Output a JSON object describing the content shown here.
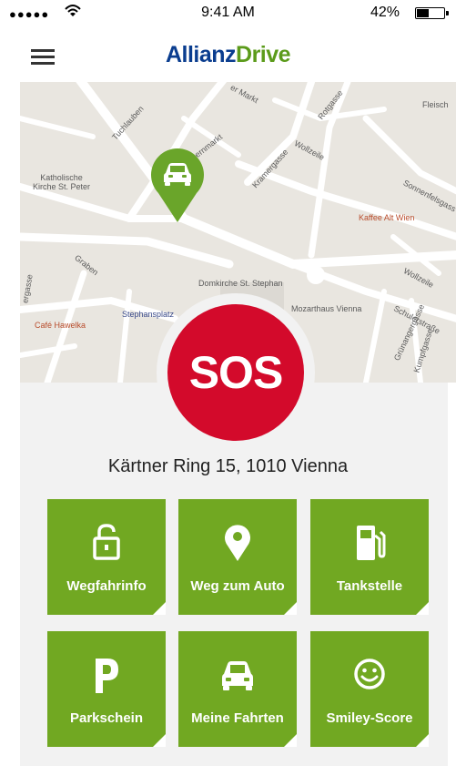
{
  "statusbar": {
    "signal": "●●●●●",
    "time": "9:41 AM",
    "battery": "42%",
    "battery_level": 0.42
  },
  "app": {
    "brand_part1": "Allianz",
    "brand_part2": "Drive"
  },
  "map": {
    "labels": {
      "tuchlauben": "Tuchlauben",
      "hoher_markt": "er Markt",
      "rotgasse": "Rotgasse",
      "fleisch": "Fleisch",
      "bauernmarkt": "Bauernmarkt",
      "kramergasse": "Kramergasse",
      "wollzeile1": "Wollzeile",
      "sonnenfels": "Sonnenfelsgass",
      "kirche": "Katholische\nKirche St. Peter",
      "kaffee": "Kaffee Alt Wien",
      "graben": "Graben",
      "wollzeile2": "Wollzeile",
      "domkirche": "Domkirche St. Stephan",
      "mozarthaus": "Mozarthaus Vienna",
      "schulerstrasse": "Schulerstraße",
      "stephansplatz": "Stephansplatz",
      "cafe_hawelka": "Café Hawelka",
      "grunangergasse": "Grünangergasse",
      "kumpfgasse": "Kumpfgasse",
      "gasse_left": "ergasse"
    }
  },
  "sos": {
    "label": "SOS"
  },
  "address": "Kärtner Ring 15, 1010 Vienna",
  "tiles": [
    {
      "label": "Wegfahrinfo",
      "icon": "unlocked-padlock-icon"
    },
    {
      "label": "Weg zum Auto",
      "icon": "location-pin-icon"
    },
    {
      "label": "Tankstelle",
      "icon": "fuel-pump-icon"
    },
    {
      "label": "Parkschein",
      "icon": "parking-icon"
    },
    {
      "label": "Meine Fahrten",
      "icon": "car-icon"
    },
    {
      "label": "Smiley-Score",
      "icon": "smiley-icon"
    }
  ],
  "colors": {
    "brand_blue": "#0a3d8f",
    "brand_green": "#5b9b1a",
    "tile_green": "#71a822",
    "sos_red": "#d30a2b",
    "map_pin": "#6aa52a"
  }
}
